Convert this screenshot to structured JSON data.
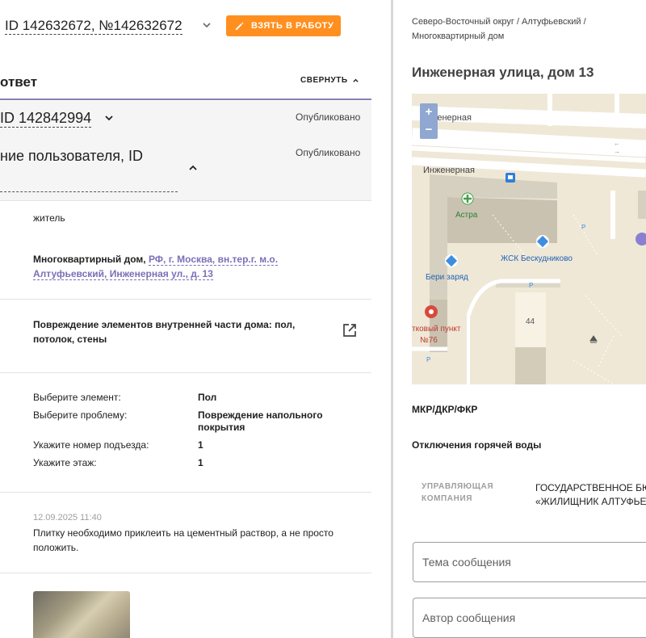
{
  "header": {
    "request_title": "ID 142632672, №142632672",
    "take_button": "ВЗЯТЬ В РАБОТУ"
  },
  "answer_section": {
    "title": "ответ",
    "collapse_label": "СВЕРНУТЬ"
  },
  "grey_block": {
    "id_label": "ID 142842994",
    "status1": "Опубликовано",
    "user_label": "ние пользователя, ID",
    "status2": "Опубликовано"
  },
  "details": {
    "role": "житель",
    "address_prefix": "Многоквартирный дом, ",
    "address_line1": "РФ, г. Москва, вн.тер.г. м.о.",
    "address_line2": "Алтуфьевский, Инженерная ул., д. 13",
    "problem_line1": "Повреждение элементов внутренней части дома: пол,",
    "problem_line2": "потолок, стены"
  },
  "fields": [
    {
      "label": "Выберите элемент:",
      "value": "Пол"
    },
    {
      "label": "Выберите проблему:",
      "value": "Повреждение напольного покрытия"
    },
    {
      "label": "Укажите номер подъезда:",
      "value": "1"
    },
    {
      "label": "Укажите этаж:",
      "value": "1"
    }
  ],
  "comment": {
    "timestamp": "12.09.2025 11:40",
    "text_line1": "Плитку необходимо приклеить на цементный раствор, а не просто",
    "text_line2": "положить."
  },
  "right": {
    "breadcrumb_line1": "Северо-Восточный округ / Алтуфьевский /",
    "breadcrumb_line2": "Многоквартирный дом",
    "address_title": "Инженерная улица, дом 13",
    "map": {
      "zoom_in": "+",
      "zoom_out": "−",
      "street1": "Инженерная",
      "street2": "Инженерная",
      "poi_astra": "Астра",
      "poi_zhsk": "ЖСК Бескудниково",
      "poi_beri": "Бери заряд",
      "poi_punkt1": "тковый пункт",
      "poi_punkt2": "№76",
      "bldg_num": "44",
      "parking": "P"
    },
    "mkr_label": "МКР/ДКР/ФКР",
    "outage_label": "Отключения горячей воды",
    "uk_label_line1": "УПРАВЛЯЮЩАЯ",
    "uk_label_line2": "КОМПАНИЯ",
    "uk_value_line1": "ГОСУДАРСТВЕННОЕ БЮ",
    "uk_value_line2": "«ЖИЛИЩНИК АЛТУФЬЕ",
    "subject_placeholder": "Тема сообщения",
    "author_placeholder": "Автор сообщения"
  },
  "colors": {
    "accent_orange": "#ff8f1f",
    "link_purple": "#7b6fb8",
    "section_underline": "#8a7fb5",
    "map_bg": "#efe8d7"
  }
}
